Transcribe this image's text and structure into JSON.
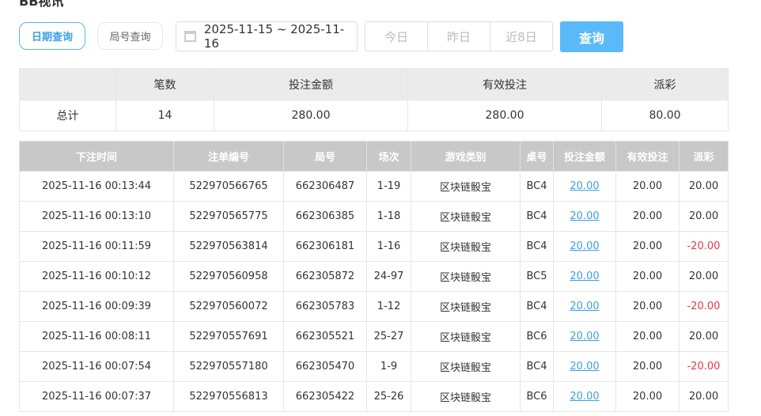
{
  "page_title": "BB视讯",
  "filters": {
    "date_query": "日期查询",
    "round_query": "局号查询",
    "date_range": "2025-11-15 ~ 2025-11-16",
    "quick": [
      "今日",
      "昨日",
      "近8日"
    ],
    "search": "查询"
  },
  "summary": {
    "headers": [
      "",
      "笔数",
      "投注金额",
      "有效投注",
      "派彩"
    ],
    "row": [
      "总计",
      "14",
      "280.00",
      "280.00",
      "80.00"
    ]
  },
  "detail": {
    "headers": [
      "下注时间",
      "注单编号",
      "局号",
      "场次",
      "游戏类别",
      "桌号",
      "投注金额",
      "有效投注",
      "派彩"
    ],
    "rows": [
      [
        "2025-11-16 00:13:44",
        "522970566765",
        "662306487",
        "1-19",
        "区块链骰宝",
        "BC4",
        "20.00",
        "20.00",
        "20.00"
      ],
      [
        "2025-11-16 00:13:10",
        "522970565775",
        "662306385",
        "1-18",
        "区块链骰宝",
        "BC4",
        "20.00",
        "20.00",
        "20.00"
      ],
      [
        "2025-11-16 00:11:59",
        "522970563814",
        "662306181",
        "1-16",
        "区块链骰宝",
        "BC4",
        "20.00",
        "20.00",
        "-20.00"
      ],
      [
        "2025-11-16 00:10:12",
        "522970560958",
        "662305872",
        "24-97",
        "区块链骰宝",
        "BC5",
        "20.00",
        "20.00",
        "20.00"
      ],
      [
        "2025-11-16 00:09:39",
        "522970560072",
        "662305783",
        "1-12",
        "区块链骰宝",
        "BC4",
        "20.00",
        "20.00",
        "-20.00"
      ],
      [
        "2025-11-16 00:08:11",
        "522970557691",
        "662305521",
        "25-27",
        "区块链骰宝",
        "BC6",
        "20.00",
        "20.00",
        "20.00"
      ],
      [
        "2025-11-16 00:07:54",
        "522970557180",
        "662305470",
        "1-9",
        "区块链骰宝",
        "BC4",
        "20.00",
        "20.00",
        "-20.00"
      ],
      [
        "2025-11-16 00:07:37",
        "522970556813",
        "662305422",
        "25-26",
        "区块链骰宝",
        "BC6",
        "20.00",
        "20.00",
        "20.00"
      ]
    ]
  },
  "colors": {
    "accent": "#5ab9f7",
    "negative": "#e8394a",
    "link": "#3aa0e8"
  }
}
